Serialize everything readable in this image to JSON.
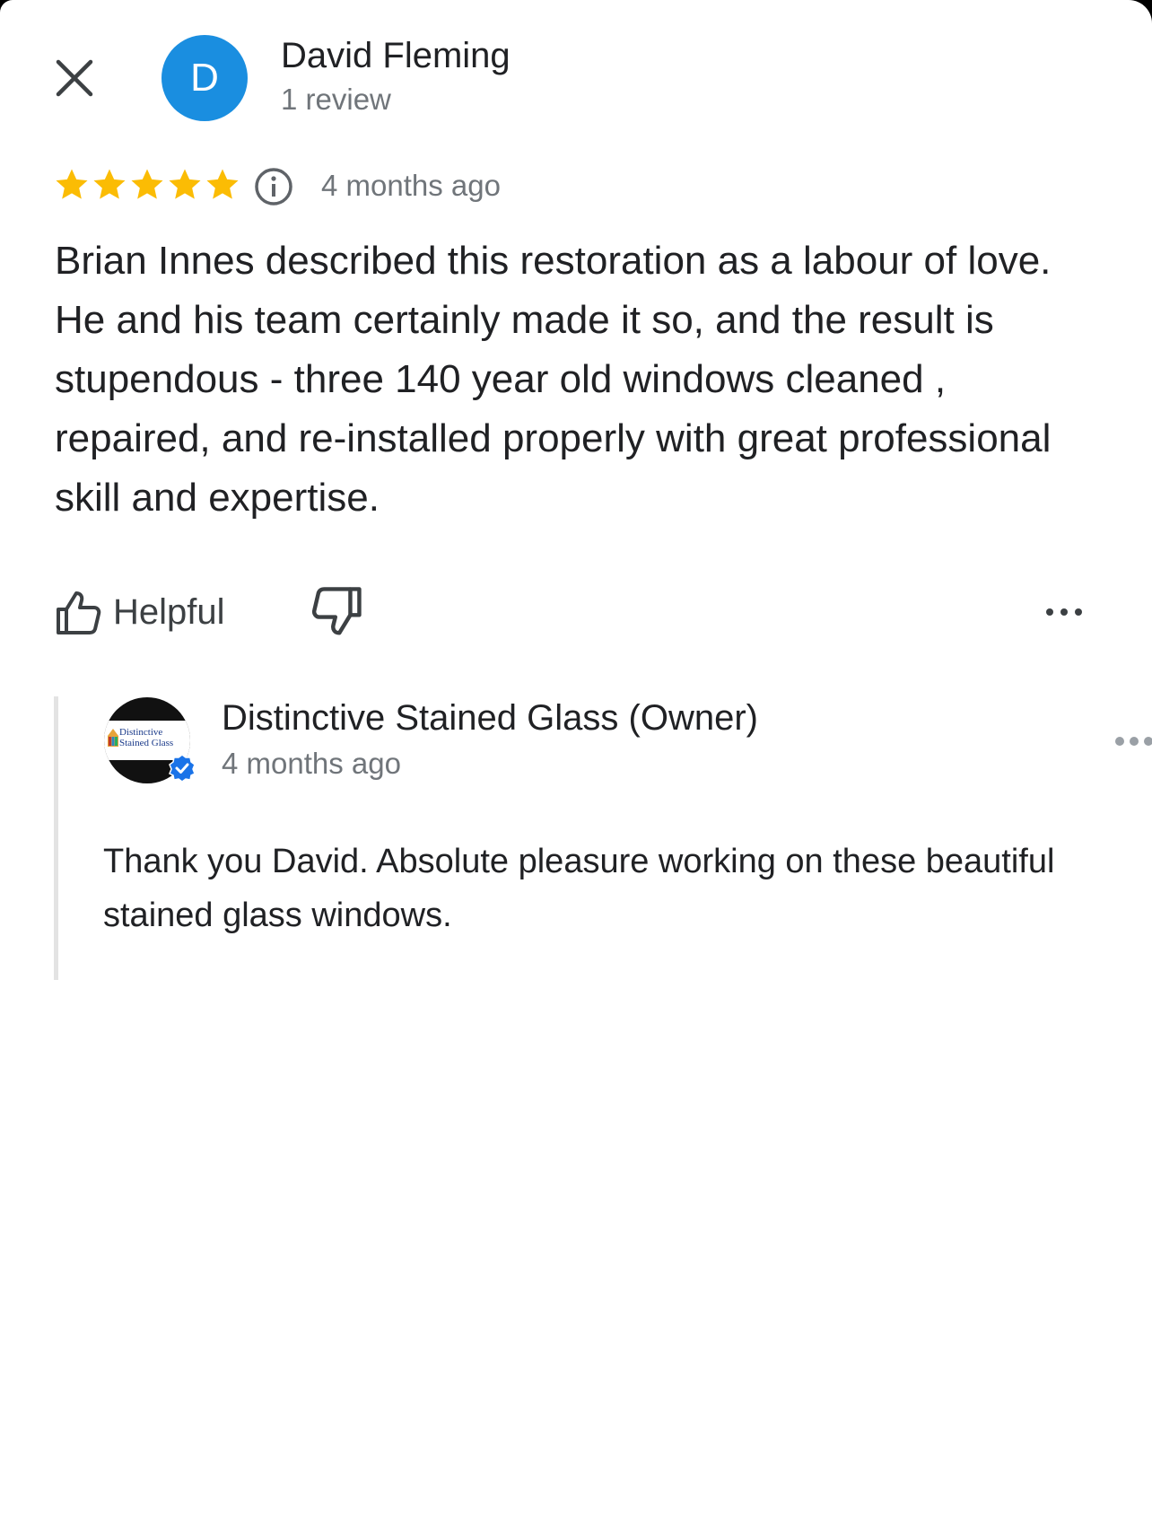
{
  "reviewer": {
    "avatar_letter": "D",
    "avatar_color": "#1a8ee0",
    "name": "David Fleming",
    "review_count": "1 review"
  },
  "review": {
    "rating": 5,
    "rating_max": 5,
    "star_color": "#fbbc04",
    "date": "4 months ago",
    "text": "Brian Innes described this restoration as a labour of love.  He and his team certainly made it so, and the result is stupendous - three 140 year old windows cleaned , repaired, and re-installed properly with great professional skill and expertise."
  },
  "actions": {
    "helpful_label": "Helpful",
    "icons": [
      "thumbs-up-icon",
      "thumbs-down-icon",
      "more-options-icon"
    ]
  },
  "owner_reply": {
    "name": "Distinctive Stained Glass (Owner)",
    "date": "4 months ago",
    "logo_text_line1": "Distinctive",
    "logo_text_line2": "Stained Glass",
    "verified_color": "#1a73e8",
    "text": "Thank you David. Absolute pleasure working on these beautiful stained glass windows."
  },
  "icons": {
    "close": "close-icon",
    "info": "info-icon",
    "verified": "verified-badge-icon"
  }
}
